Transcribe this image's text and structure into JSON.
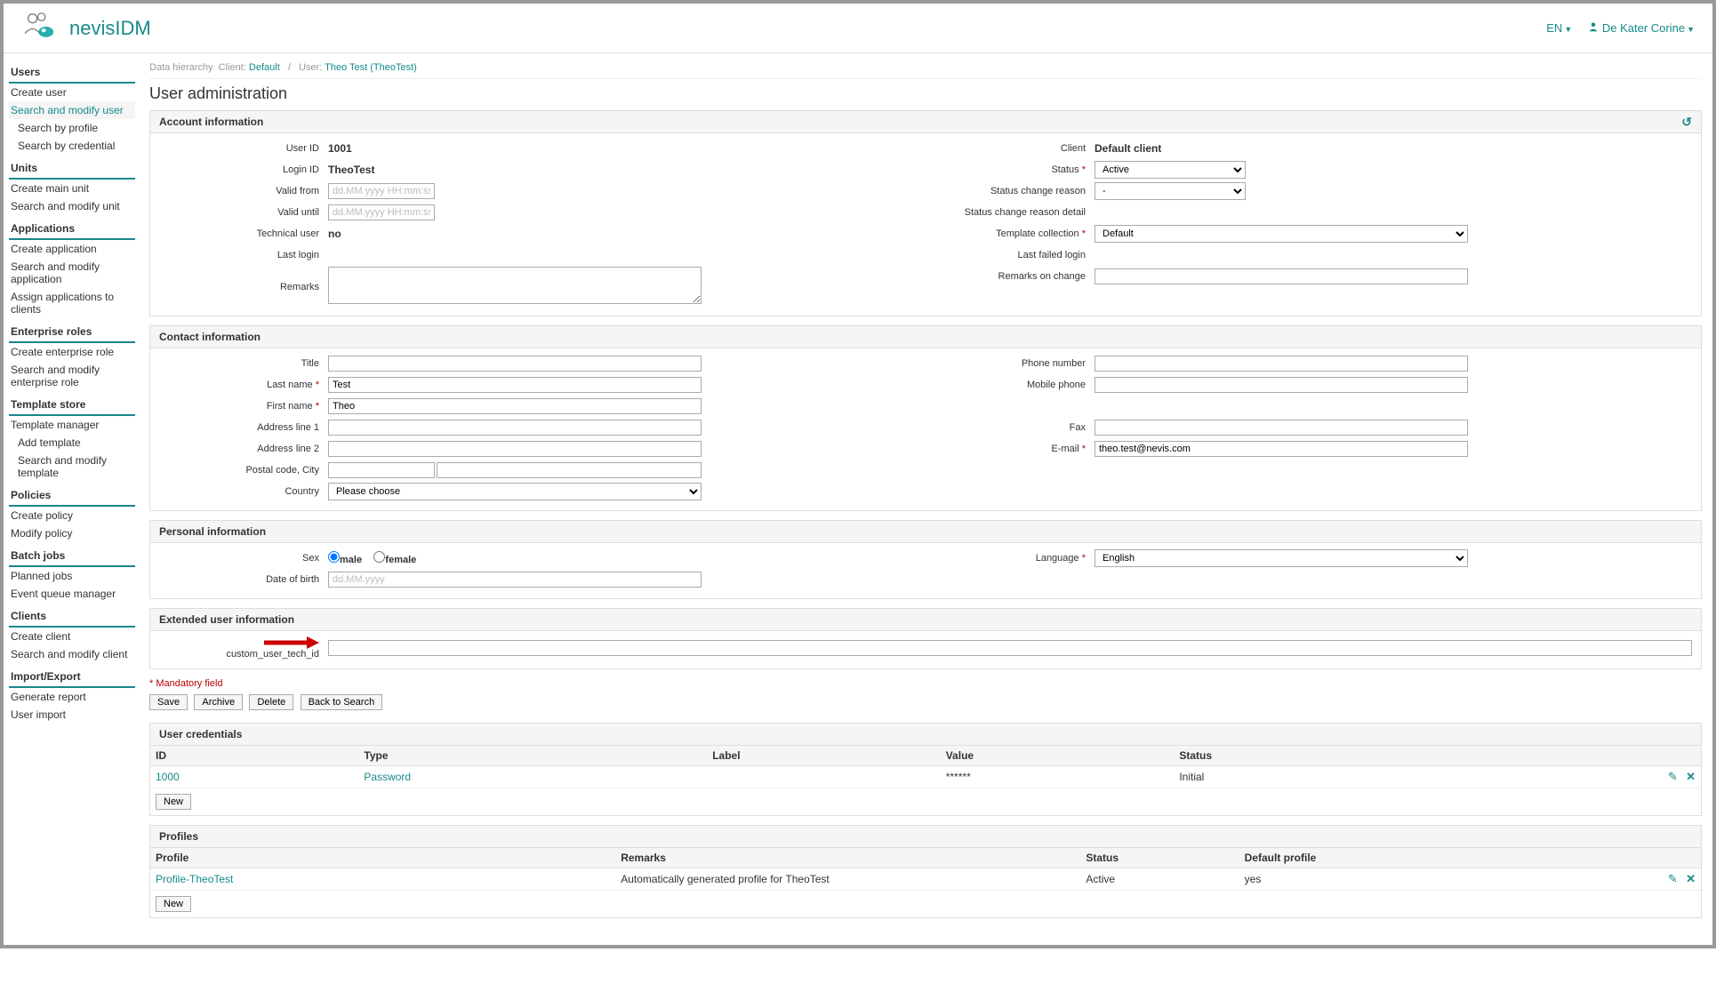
{
  "header": {
    "app_title": "nevisIDM",
    "lang": "EN",
    "user_name": "De Kater Corine"
  },
  "sidebar": {
    "users": {
      "title": "Users",
      "create": "Create user",
      "search_modify": "Search and modify user",
      "search_profile": "Search by profile",
      "search_credential": "Search by credential"
    },
    "units": {
      "title": "Units",
      "create": "Create main unit",
      "search_modify": "Search and modify unit"
    },
    "applications": {
      "title": "Applications",
      "create": "Create application",
      "search_modify": "Search and modify application",
      "assign": "Assign applications to clients"
    },
    "enterprise_roles": {
      "title": "Enterprise roles",
      "create": "Create enterprise role",
      "search_modify": "Search and modify enterprise role"
    },
    "template_store": {
      "title": "Template store",
      "manager": "Template manager",
      "add": "Add template",
      "search_modify": "Search and modify template"
    },
    "policies": {
      "title": "Policies",
      "create": "Create policy",
      "modify": "Modify policy"
    },
    "batch_jobs": {
      "title": "Batch jobs",
      "planned": "Planned jobs",
      "event_queue": "Event queue manager"
    },
    "clients": {
      "title": "Clients",
      "create": "Create client",
      "search_modify": "Search and modify client"
    },
    "import_export": {
      "title": "Import/Export",
      "generate": "Generate report",
      "import": "User import"
    }
  },
  "breadcrumb": {
    "prefix": "Data hierarchy",
    "client_label": "Client:",
    "client_value": "Default",
    "user_label": "User:",
    "user_value": "Theo Test (TheoTest)"
  },
  "page_title": "User administration",
  "account": {
    "section": "Account information",
    "labels": {
      "user_id": "User ID",
      "login_id": "Login ID",
      "valid_from": "Valid from",
      "valid_until": "Valid until",
      "technical_user": "Technical user",
      "last_login": "Last login",
      "remarks": "Remarks",
      "client": "Client",
      "status": "Status",
      "status_change_reason": "Status change reason",
      "status_change_reason_detail": "Status change reason detail",
      "template_collection": "Template collection",
      "last_failed_login": "Last failed login",
      "remarks_on_change": "Remarks on change"
    },
    "values": {
      "user_id": "1001",
      "login_id": "TheoTest",
      "technical_user": "no",
      "client": "Default client",
      "status": "Active",
      "status_change_reason": "-",
      "template_collection": "Default"
    },
    "placeholders": {
      "date": "dd.MM.yyyy HH:mm:ss"
    }
  },
  "contact": {
    "section": "Contact information",
    "labels": {
      "title": "Title",
      "last_name": "Last name",
      "first_name": "First name",
      "address1": "Address line 1",
      "address2": "Address line 2",
      "postal_city": "Postal code, City",
      "country": "Country",
      "phone": "Phone number",
      "mobile": "Mobile phone",
      "fax": "Fax",
      "email": "E-mail"
    },
    "values": {
      "last_name": "Test",
      "first_name": "Theo",
      "email": "theo.test@nevis.com",
      "country": "Please choose"
    }
  },
  "personal": {
    "section": "Personal information",
    "labels": {
      "sex": "Sex",
      "dob": "Date of birth",
      "language": "Language",
      "male": "male",
      "female": "female"
    },
    "values": {
      "sex": "male",
      "language": "English"
    },
    "placeholders": {
      "dob": "dd.MM.yyyy"
    }
  },
  "extended": {
    "section": "Extended user information",
    "labels": {
      "custom_id": "custom_user_tech_id"
    }
  },
  "mandatory_note": "* Mandatory field",
  "buttons": {
    "save": "Save",
    "archive": "Archive",
    "delete": "Delete",
    "back": "Back to Search",
    "new": "New"
  },
  "credentials": {
    "section": "User credentials",
    "headers": {
      "id": "ID",
      "type": "Type",
      "label": "Label",
      "value": "Value",
      "status": "Status"
    },
    "rows": [
      {
        "id": "1000",
        "type": "Password",
        "label": "",
        "value": "******",
        "status": "Initial"
      }
    ]
  },
  "profiles": {
    "section": "Profiles",
    "headers": {
      "profile": "Profile",
      "remarks": "Remarks",
      "status": "Status",
      "default": "Default profile"
    },
    "rows": [
      {
        "profile": "Profile-TheoTest",
        "remarks": "Automatically generated profile for TheoTest",
        "status": "Active",
        "default": "yes"
      }
    ]
  }
}
